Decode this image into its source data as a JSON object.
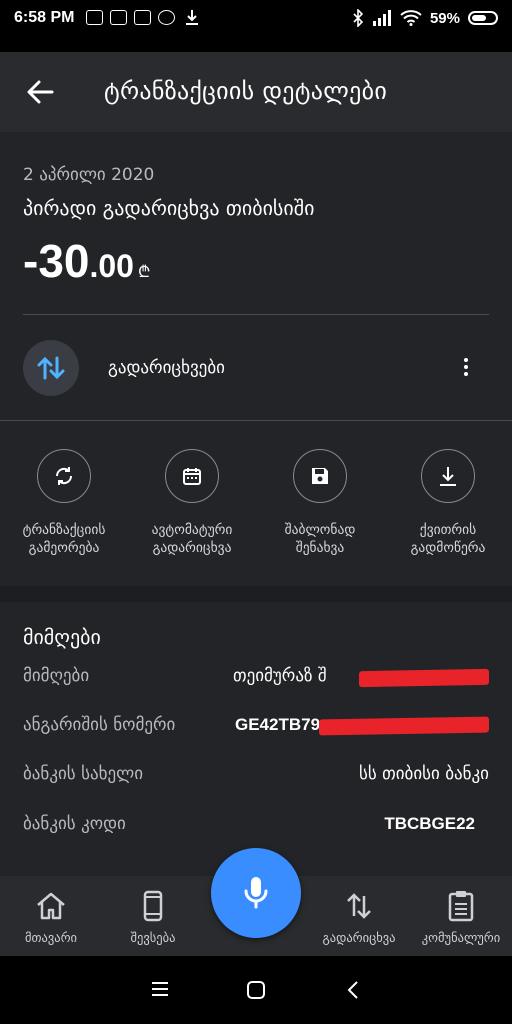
{
  "status": {
    "time": "6:58 PM",
    "battery": "59%"
  },
  "appbar": {
    "title": "ტრანზაქციის დეტალები"
  },
  "transaction": {
    "date": "2 აპრილი 2020",
    "description": "პირადი გადარიცხვა თიბისიში",
    "amount_int": "-30",
    "amount_dec": ".00",
    "currency": "₾",
    "category": "გადარიცხვები"
  },
  "actions": [
    {
      "label": "ტრანზაქციის\nგამეორება",
      "icon": "repeat-icon"
    },
    {
      "label": "ავტომატური\nგადარიცხვა",
      "icon": "calendar-icon"
    },
    {
      "label": "შაბლონად\nშენახვა",
      "icon": "save-icon"
    },
    {
      "label": "ქვითრის\nგადმოწერა",
      "icon": "download-icon"
    }
  ],
  "recipient": {
    "title": "მიმღები",
    "rows": [
      {
        "key": "მიმღები",
        "value": "თეიმურაზ შ"
      },
      {
        "key": "ანგარიშის ნომერი",
        "value": "GE42TB79"
      },
      {
        "key": "ბანკის სახელი",
        "value": "სს თიბისი ბანკი"
      },
      {
        "key": "ბანკის კოდი",
        "value": "TBCBGE22"
      }
    ]
  },
  "bottomnav": [
    {
      "label": "მთავარი",
      "icon": "home-icon"
    },
    {
      "label": "შევსება",
      "icon": "phone-icon"
    },
    {
      "label": "გადარიცხვა",
      "icon": "transfer-icon"
    },
    {
      "label": "კომუნალური",
      "icon": "clipboard-icon"
    }
  ],
  "colors": {
    "accent": "#3a8dff",
    "redaction": "#e8232a",
    "background": "#1d1e21"
  }
}
